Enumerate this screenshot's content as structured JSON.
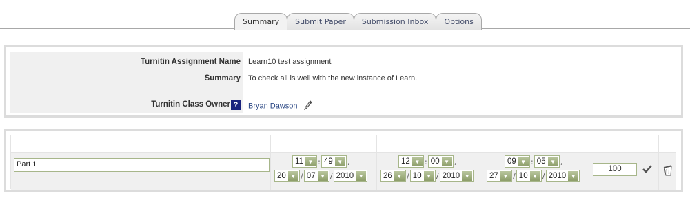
{
  "tabs": [
    {
      "label": "Summary",
      "active": true
    },
    {
      "label": "Submit Paper",
      "active": false
    },
    {
      "label": "Submission Inbox",
      "active": false
    },
    {
      "label": "Options",
      "active": false
    }
  ],
  "info": {
    "assignment_name_label": "Turnitin Assignment Name",
    "assignment_name_value": "Learn10 test assignment",
    "summary_label": "Summary",
    "summary_value": "To check all is well with the new instance of Learn.",
    "owner_label": "Turnitin Class Owner",
    "help_icon": "?",
    "owner_value": "Bryan Dawson"
  },
  "part": {
    "name": "Part 1",
    "start": {
      "hour": "11",
      "minute": "49",
      "day": "20",
      "month": "07",
      "year": "2010"
    },
    "due": {
      "hour": "12",
      "minute": "00",
      "day": "26",
      "month": "10",
      "year": "2010"
    },
    "post": {
      "hour": "09",
      "minute": "05",
      "day": "27",
      "month": "10",
      "year": "2010"
    },
    "max_marks": "100",
    "time_separator": ":",
    "date_separator": "/",
    "comma": ","
  },
  "colors": {
    "accent_green": "#a7b68a",
    "link_blue": "#2e4a86",
    "panel_gray": "#dcdcdc"
  },
  "icons": {
    "help": "help-icon",
    "edit": "pencil-icon",
    "save": "checkmark-icon",
    "delete": "trash-icon"
  }
}
